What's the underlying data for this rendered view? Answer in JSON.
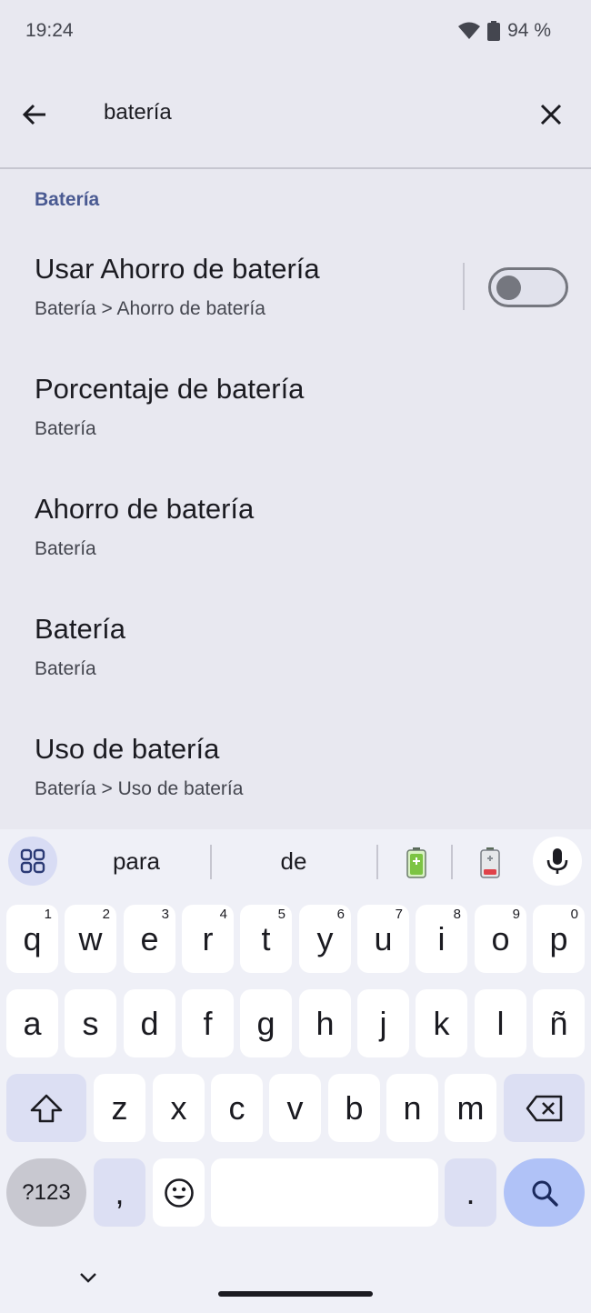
{
  "status_bar": {
    "time": "19:24",
    "battery_percent": "94 %",
    "icons": [
      "wifi-icon",
      "battery-icon"
    ]
  },
  "search": {
    "query": "batería",
    "back_icon": "arrow-back-icon",
    "clear_icon": "close-icon"
  },
  "results": {
    "section_header": "Batería",
    "items": [
      {
        "title": "Usar Ahorro de batería",
        "subtitle": "Batería > Ahorro de batería",
        "toggle_on": false
      },
      {
        "title": "Porcentaje de batería",
        "subtitle": "Batería"
      },
      {
        "title": "Ahorro de batería",
        "subtitle": "Batería"
      },
      {
        "title": "Batería",
        "subtitle": "Batería"
      },
      {
        "title": "Uso de batería",
        "subtitle": "Batería > Uso de batería"
      }
    ]
  },
  "keyboard": {
    "suggestions": [
      "para",
      "de"
    ],
    "emoji_suggestions": [
      "battery-full-emoji",
      "battery-low-emoji"
    ],
    "row1": [
      {
        "key": "q",
        "hint": "1"
      },
      {
        "key": "w",
        "hint": "2"
      },
      {
        "key": "e",
        "hint": "3"
      },
      {
        "key": "r",
        "hint": "4"
      },
      {
        "key": "t",
        "hint": "5"
      },
      {
        "key": "y",
        "hint": "6"
      },
      {
        "key": "u",
        "hint": "7"
      },
      {
        "key": "i",
        "hint": "8"
      },
      {
        "key": "o",
        "hint": "9"
      },
      {
        "key": "p",
        "hint": "0"
      }
    ],
    "row2": [
      "a",
      "s",
      "d",
      "f",
      "g",
      "h",
      "j",
      "k",
      "l",
      "ñ"
    ],
    "row3": [
      "z",
      "x",
      "c",
      "v",
      "b",
      "n",
      "m"
    ],
    "symbols_label": "?123",
    "comma_label": ",",
    "period_label": "."
  },
  "colors": {
    "background": "#e8e8f0",
    "section_header": "#4a5a92",
    "search_key": "#b0c2f7",
    "function_key": "#dcdff3"
  }
}
